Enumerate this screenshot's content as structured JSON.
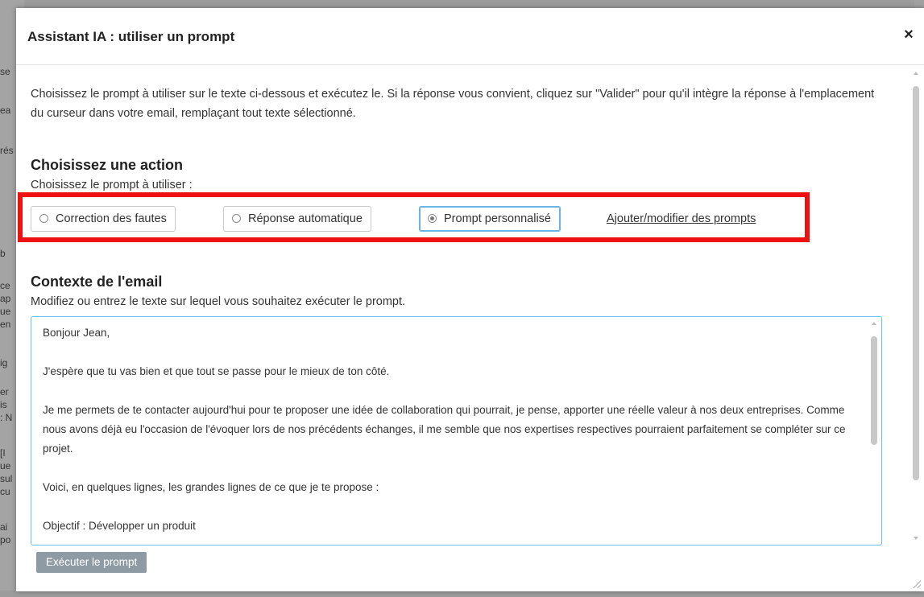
{
  "modal": {
    "title": "Assistant IA : utiliser un prompt",
    "close_label": "×",
    "intro": "Choisissez le prompt à utiliser sur le texte ci-dessous et exécutez le. Si la réponse vous convient, cliquez sur \"Valider\" pour qu'il intègre la réponse à l'emplacement du curseur dans votre email, remplaçant tout texte sélectionné."
  },
  "action": {
    "title": "Choisissez une action",
    "subtitle": "Choisissez le prompt à utiliser :",
    "options": [
      {
        "label": "Correction des fautes",
        "selected": false
      },
      {
        "label": "Réponse automatique",
        "selected": false
      },
      {
        "label": "Prompt personnalisé",
        "selected": true
      }
    ],
    "link": "Ajouter/modifier des prompts"
  },
  "context": {
    "title": "Contexte de l'email",
    "subtitle": "Modifiez ou entrez le texte sur lequel vous souhaitez exécuter le prompt.",
    "paragraphs": [
      "Bonjour Jean,",
      "J'espère que tu vas bien et que tout se passe pour le mieux de ton côté.",
      "Je me permets de te contacter aujourd'hui pour te proposer une idée de collaboration qui pourrait, je pense, apporter une réelle valeur à nos deux entreprises. Comme nous avons déjà eu l'occasion de l'évoquer lors de nos précédents échanges, il me semble que nos expertises respectives pourraient parfaitement se compléter sur ce projet.",
      "Voici, en quelques lignes, les grandes lignes de ce que je te propose :",
      "Objectif : Développer un produit"
    ]
  },
  "footer": {
    "execute_label": "Exécuter le prompt"
  },
  "colors": {
    "highlight": "#ee1111",
    "selected_border": "#6ab4e6",
    "textarea_border": "#6ac0ea",
    "button_bg": "#8e9aa4"
  },
  "background_fragments": [
    "se",
    "ea",
    "rés",
    "b",
    "ce",
    "ap",
    "ue",
    "en",
    "ig",
    "er",
    "is",
    ": N",
    "[I",
    "ue",
    "sul",
    "cu",
    "ai",
    "po"
  ]
}
